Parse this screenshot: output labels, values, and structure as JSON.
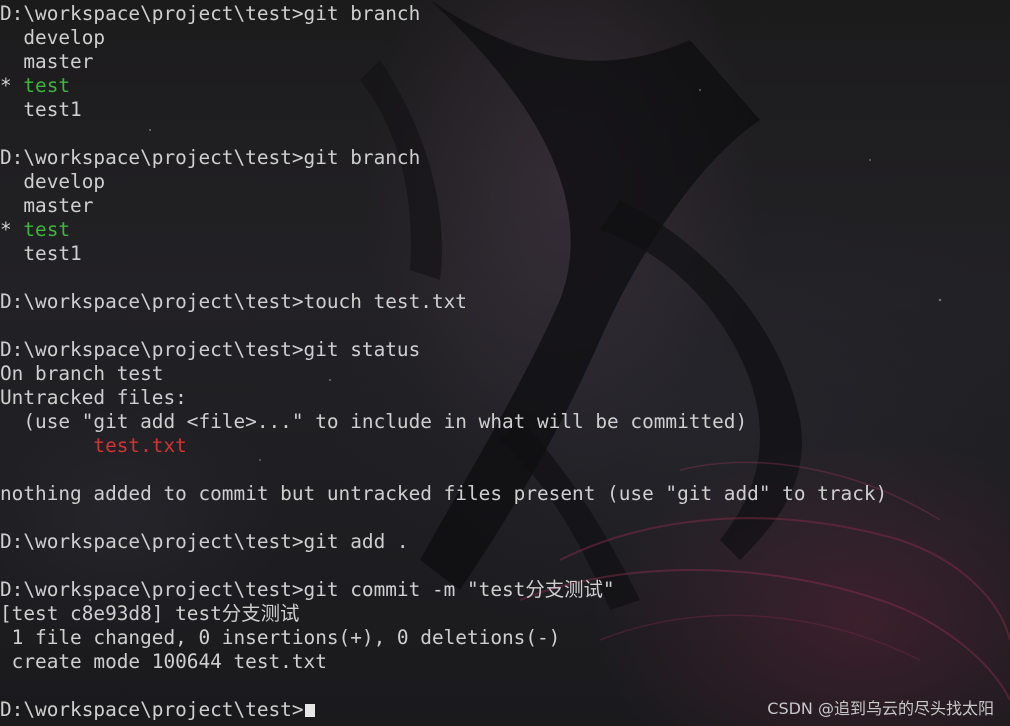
{
  "terminal": {
    "lines": [
      {
        "text": "D:\\workspace\\project\\test>git branch"
      },
      {
        "text": "  develop"
      },
      {
        "text": "  master"
      },
      {
        "prefix": "* ",
        "text": "test",
        "accent": "#3fb53f"
      },
      {
        "text": "  test1"
      },
      {
        "text": ""
      },
      {
        "text": "D:\\workspace\\project\\test>git branch"
      },
      {
        "text": "  develop"
      },
      {
        "text": "  master"
      },
      {
        "prefix": "* ",
        "text": "test",
        "accent": "#3fb53f"
      },
      {
        "text": "  test1"
      },
      {
        "text": ""
      },
      {
        "text": "D:\\workspace\\project\\test>touch test.txt"
      },
      {
        "text": ""
      },
      {
        "text": "D:\\workspace\\project\\test>git status"
      },
      {
        "text": "On branch test"
      },
      {
        "text": "Untracked files:"
      },
      {
        "text": "  (use \"git add <file>...\" to include in what will be committed)"
      },
      {
        "prefix": "        ",
        "text": "test.txt",
        "accent": "#d23333"
      },
      {
        "text": ""
      },
      {
        "text": "nothing added to commit but untracked files present (use \"git add\" to track)"
      },
      {
        "text": ""
      },
      {
        "text": "D:\\workspace\\project\\test>git add ."
      },
      {
        "text": ""
      },
      {
        "text": "D:\\workspace\\project\\test>git commit -m \"test分支测试\""
      },
      {
        "text": "[test c8e93d8] test分支测试"
      },
      {
        "text": " 1 file changed, 0 insertions(+), 0 deletions(-)"
      },
      {
        "text": " create mode 100644 test.txt"
      },
      {
        "text": ""
      },
      {
        "text": "D:\\workspace\\project\\test>",
        "cursor": true
      }
    ]
  },
  "watermark": "CSDN @追到乌云的尽头找太阳",
  "colors": {
    "text": "#cfcfcf",
    "current_branch": "#3fb53f",
    "untracked_file": "#d23333"
  }
}
